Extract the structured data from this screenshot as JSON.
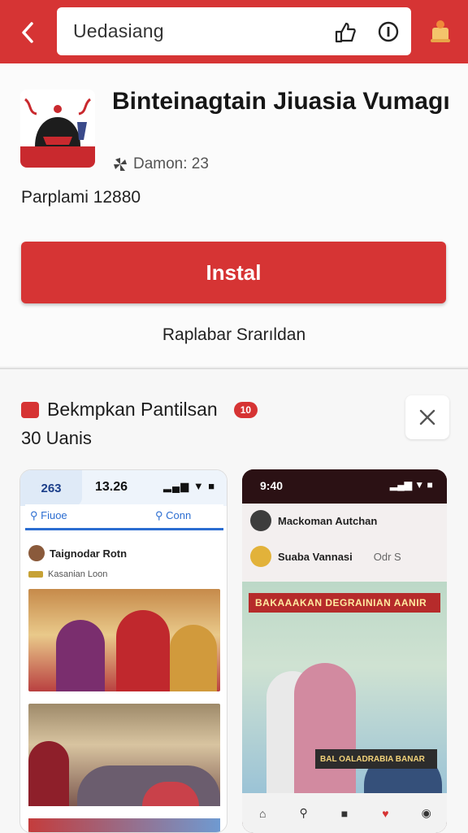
{
  "topbar": {
    "search_text": "Uedasiang",
    "icons": [
      "back-arrow-icon",
      "share-icon",
      "info-icon",
      "bell-icon"
    ]
  },
  "app": {
    "title": "Binteinagtain Jiuasia Vumagı",
    "dev_label": "Damon: 23",
    "install_count": "Parplami 12880",
    "install_label": "Instal",
    "secondary_link": "Raplabar Srarıldan",
    "accent_color": "#d63434"
  },
  "section": {
    "title": "Bekmpkan Pantilsan",
    "badge": "10",
    "subtitle": "30 Uanis"
  },
  "screenshot_light": {
    "tab_label": "263",
    "clock": "13.26",
    "signal": "▂▄▆ ▼ ■",
    "search_left": "Fiuoe",
    "search_right": "Conn",
    "post_title": "Taignodar Rotn",
    "post_sub": "Kasanian Loon"
  },
  "screenshot_dark": {
    "clock": "9:40",
    "signal": "▂▄▆ ▼ ■",
    "line1": "Mackoman Autchan",
    "line2": "Suaba Vannasi",
    "line2_meta": "Odr S",
    "banner": "BAKAAAKAN DEGRAINIAN AANIR",
    "poster_footer": "BAL OALADRABIA BANAR"
  }
}
